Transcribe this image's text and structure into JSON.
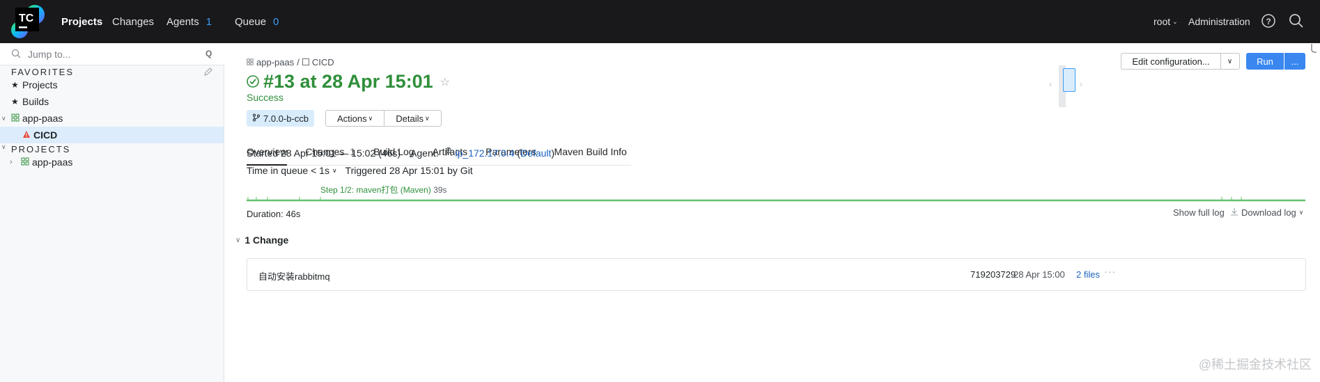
{
  "brand": {
    "logo_text": "TC"
  },
  "nav": {
    "projects": "Projects",
    "changes": "Changes",
    "agents": "Agents",
    "agents_count": "1",
    "queue": "Queue",
    "queue_count": "0",
    "user": "root",
    "administration": "Administration"
  },
  "sidebar": {
    "search_placeholder": "Jump to...",
    "search_shortcut": "Q",
    "favorites_title": "FAVORITES",
    "favorites": [
      "Projects",
      "Builds",
      "app-paas",
      "CICD"
    ],
    "projects_title": "PROJECTS",
    "projects": [
      "app-paas"
    ]
  },
  "build": {
    "breadcrumb_project": "app-paas",
    "breadcrumb_sep": "/",
    "breadcrumb_config": "CICD",
    "title": "#13 at 28 Apr 15:01",
    "status": "Success",
    "branch": "7.0.0-b-ccb",
    "actions_label": "Actions",
    "details_label": "Details",
    "edit_config_label": "Edit configuration...",
    "run_label": "Run",
    "run_more_label": "..."
  },
  "tabs": [
    {
      "label": "Overview",
      "count": ""
    },
    {
      "label": "Changes",
      "count": "1"
    },
    {
      "label": "Build Log",
      "count": ""
    },
    {
      "label": "Artifacts",
      "count": ""
    },
    {
      "label": "Parameters",
      "count": ""
    },
    {
      "label": "Maven Build Info",
      "count": ""
    }
  ],
  "overview": {
    "started": "Started 28 Apr 15:01 — 15:02 (46s)",
    "agent_label": "Agent:",
    "agent_name": "ip_172.17.0.4",
    "agent_pool": "Default",
    "queue_time": "Time in queue < 1s",
    "triggered": "Triggered 28 Apr 15:01 by Git",
    "step_label": "Step 1/2: maven打包 (Maven)",
    "step_duration": "39s",
    "duration": "Duration: 46s",
    "show_full_log": "Show full log",
    "download_log": "Download log"
  },
  "changes": {
    "header": "1 Change",
    "items": [
      {
        "comment": "自动安装rabbitmq",
        "revision": "719203729",
        "date": "28 Apr 15:00",
        "files": "2 files"
      }
    ]
  },
  "watermark": "@稀土掘金技术社区",
  "colors": {
    "topbar": "#19191c",
    "success": "#2f8f3a",
    "link": "#1d62bf",
    "accent": "#3d9bf2",
    "run_button": "#3a87f0"
  }
}
